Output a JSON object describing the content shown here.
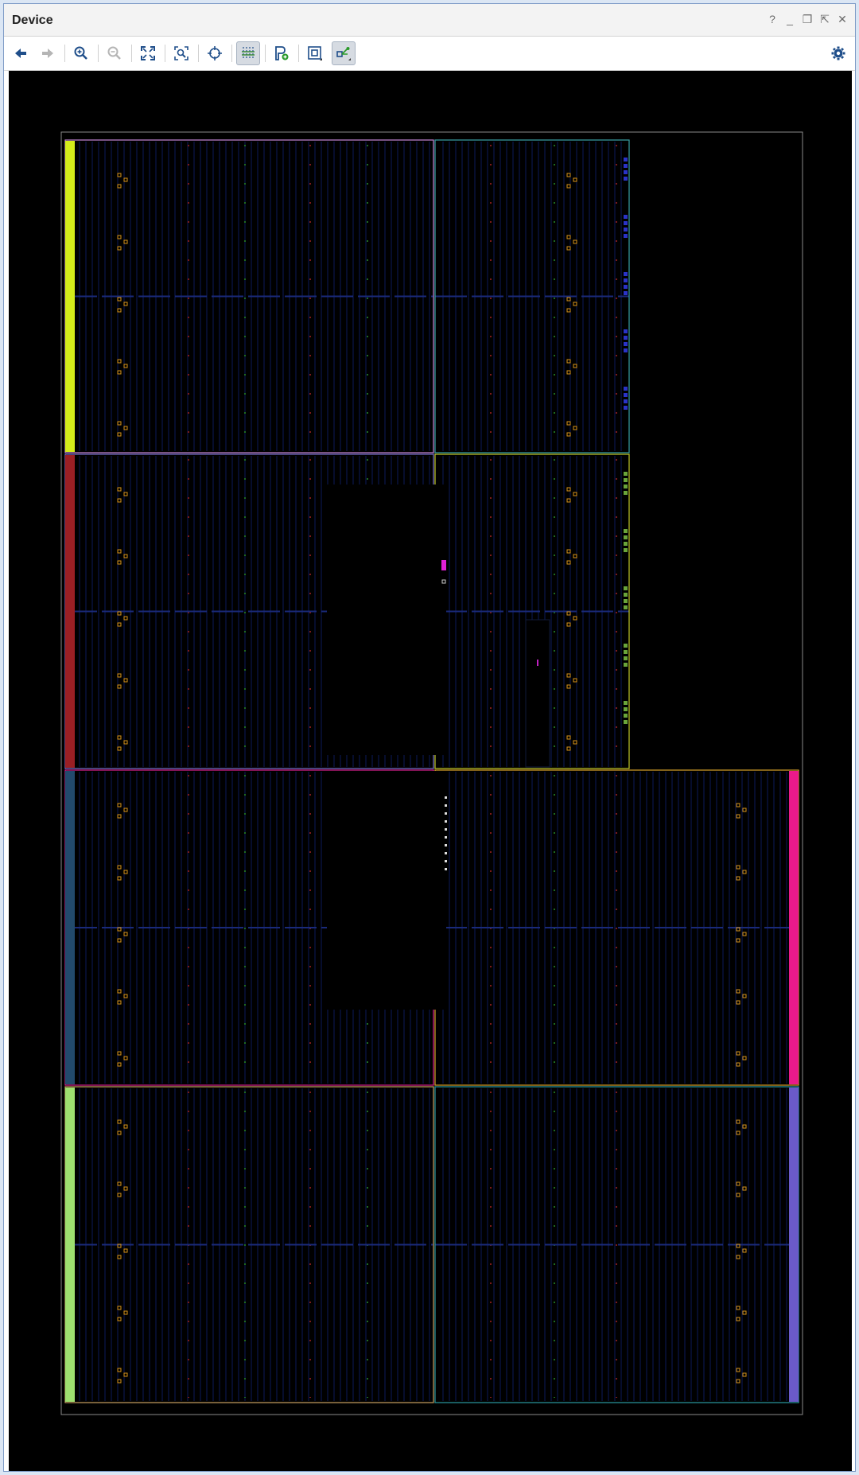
{
  "window": {
    "title": "Device"
  },
  "window_controls": [
    {
      "name": "help",
      "glyph": "?"
    },
    {
      "name": "minimize",
      "glyph": "_"
    },
    {
      "name": "restore",
      "glyph": "❐"
    },
    {
      "name": "float",
      "glyph": "⇱"
    },
    {
      "name": "close",
      "glyph": "✕"
    }
  ],
  "toolbar": {
    "buttons": [
      {
        "name": "back",
        "icon": "arrow-left-icon",
        "enabled": true
      },
      {
        "name": "forward",
        "icon": "arrow-right-icon",
        "enabled": false
      },
      {
        "name": "zoom-in",
        "icon": "zoom-in-icon",
        "enabled": true
      },
      {
        "name": "zoom-out",
        "icon": "zoom-out-icon",
        "enabled": false
      },
      {
        "name": "zoom-fit",
        "icon": "fit-icon",
        "enabled": true
      },
      {
        "name": "zoom-selected",
        "icon": "zoom-selected-icon",
        "enabled": true
      },
      {
        "name": "auto-fit",
        "icon": "crosshair-icon",
        "enabled": true
      },
      {
        "name": "routing-resources",
        "icon": "routing-icon",
        "enabled": true,
        "active": true
      },
      {
        "name": "add-pblock",
        "icon": "pblock-add-icon",
        "enabled": true
      },
      {
        "name": "draw-pblock",
        "icon": "pblock-draw-icon",
        "enabled": true
      },
      {
        "name": "show-connections",
        "icon": "connections-icon",
        "enabled": true,
        "active": true
      },
      {
        "name": "settings",
        "icon": "gear-icon",
        "enabled": true
      }
    ]
  },
  "device_view": {
    "background": "#000000",
    "clock_regions": [
      {
        "row": 0,
        "col": 0,
        "color": "#c889d8",
        "strip": "#d4ec1a"
      },
      {
        "row": 0,
        "col": 1,
        "color": "#3aa3a8",
        "io": "#2a33c8"
      },
      {
        "row": 1,
        "col": 0,
        "color": "#7a72d0",
        "strip": "#9a1f24"
      },
      {
        "row": 1,
        "col": 1,
        "color": "#c4cc2a",
        "io": "#6aa53a"
      },
      {
        "row": 2,
        "col": 0,
        "color": "#d8208e",
        "strip": "#224a6c"
      },
      {
        "row": 2,
        "col": 1,
        "color": "#d8a22a",
        "strip": "#ea1a8a"
      },
      {
        "row": 3,
        "col": 0,
        "color": "#c8a060",
        "strip": "#9ee070"
      },
      {
        "row": 3,
        "col": 1,
        "color": "#2a9aa0",
        "strip": "#6a5ac8"
      }
    ]
  }
}
